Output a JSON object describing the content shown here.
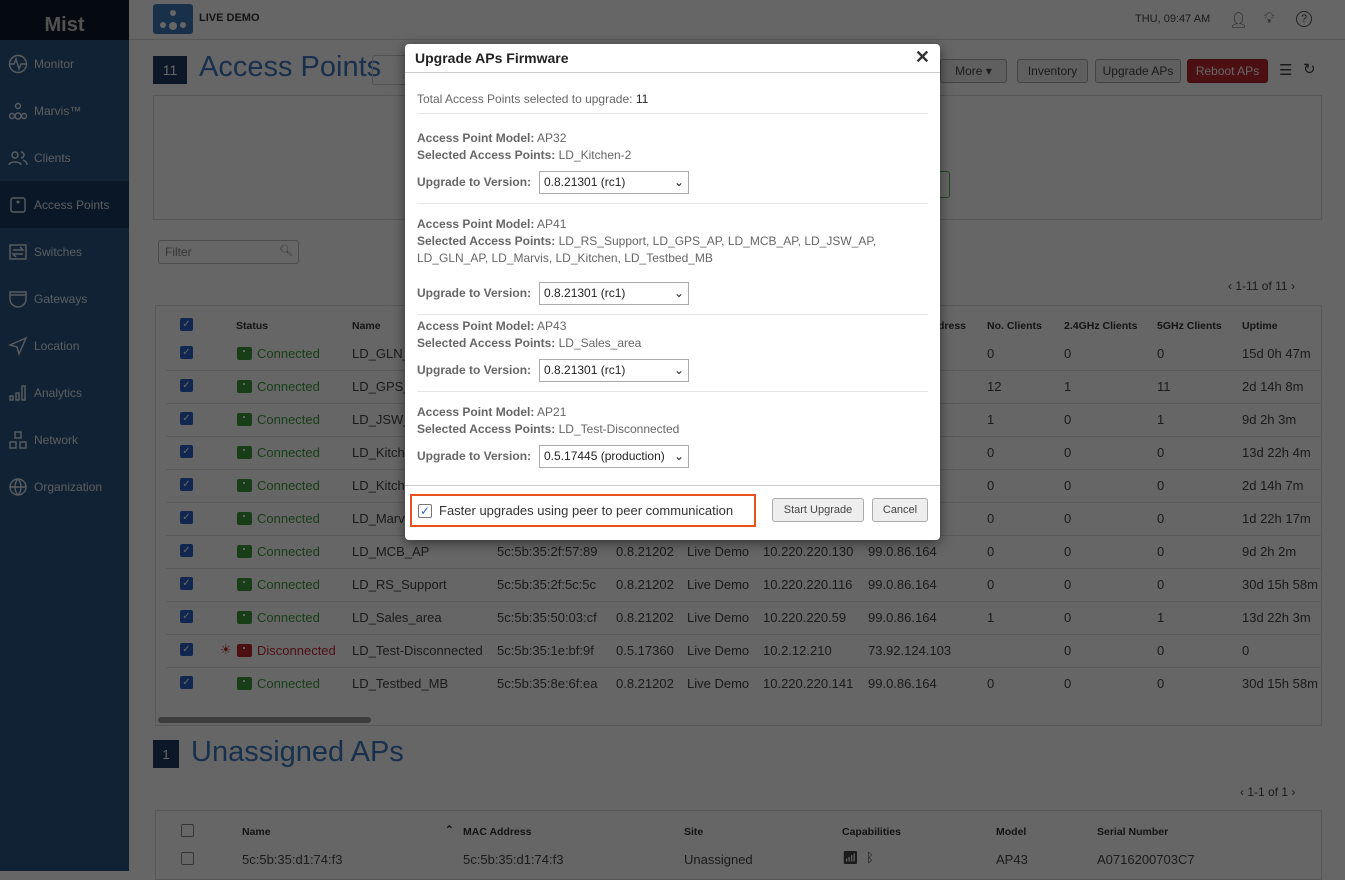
{
  "brand": "Mist",
  "site": "LIVE DEMO",
  "datetime": "THU, 09:47 AM",
  "sidebar": {
    "items": [
      {
        "label": "Monitor",
        "icon": "monitor-icon"
      },
      {
        "label": "Marvis™",
        "icon": "marvis-icon"
      },
      {
        "label": "Clients",
        "icon": "clients-icon"
      },
      {
        "label": "Access Points",
        "icon": "access-point-icon",
        "active": true
      },
      {
        "label": "Switches",
        "icon": "switches-icon"
      },
      {
        "label": "Gateways",
        "icon": "gateways-icon"
      },
      {
        "label": "Location",
        "icon": "location-icon"
      },
      {
        "label": "Analytics",
        "icon": "analytics-icon"
      },
      {
        "label": "Network",
        "icon": "network-icon"
      },
      {
        "label": "Organization",
        "icon": "organization-icon"
      }
    ]
  },
  "ap": {
    "count": "11",
    "title": "Access Points",
    "toolbar": {
      "more": "More",
      "inventory": "Inventory",
      "upgrade": "Upgrade APs",
      "reboot": "Reboot APs"
    },
    "filter_placeholder": "Filter",
    "pagination": "1-11 of 11",
    "headers": {
      "status": "Status",
      "name": "Name",
      "address": "Address",
      "clients": "No. Clients",
      "c24": "2.4GHz Clients",
      "c5": "5GHz Clients",
      "uptime": "Uptime"
    },
    "rows": [
      {
        "status": "Connected",
        "name": "LD_GLN_AP",
        "mac": "",
        "ver": "",
        "site": "",
        "ip": "",
        "ext": "",
        "clients": "0",
        "c24": "0",
        "c5": "0",
        "uptime": "15d 0h 47m"
      },
      {
        "status": "Connected",
        "name": "LD_GPS_AP",
        "mac": "",
        "ver": "",
        "site": "",
        "ip": "",
        "ext": "",
        "clients": "12",
        "c24": "1",
        "c5": "11",
        "uptime": "2d 14h 8m"
      },
      {
        "status": "Connected",
        "name": "LD_JSW_AP",
        "mac": "",
        "ver": "",
        "site": "",
        "ip": "",
        "ext": "",
        "clients": "1",
        "c24": "0",
        "c5": "1",
        "uptime": "9d 2h 3m"
      },
      {
        "status": "Connected",
        "name": "LD_Kitchen",
        "mac": "",
        "ver": "",
        "site": "",
        "ip": "",
        "ext": "",
        "clients": "0",
        "c24": "0",
        "c5": "0",
        "uptime": "13d 22h 4m"
      },
      {
        "status": "Connected",
        "name": "LD_Kitchen-2",
        "mac": "",
        "ver": "",
        "site": "",
        "ip": "",
        "ext": "",
        "clients": "0",
        "c24": "0",
        "c5": "0",
        "uptime": "2d 14h 7m"
      },
      {
        "status": "Connected",
        "name": "LD_Marvis",
        "mac": "",
        "ver": "",
        "site": "",
        "ip": "",
        "ext": "",
        "clients": "0",
        "c24": "0",
        "c5": "0",
        "uptime": "1d 22h 17m"
      },
      {
        "status": "Connected",
        "name": "LD_MCB_AP",
        "mac": "5c:5b:35:2f:57:89",
        "ver": "0.8.21202",
        "site": "Live Demo",
        "ip": "10.220.220.130",
        "ext": "99.0.86.164",
        "clients": "0",
        "c24": "0",
        "c5": "0",
        "uptime": "9d 2h 2m"
      },
      {
        "status": "Connected",
        "name": "LD_RS_Support",
        "mac": "5c:5b:35:2f:5c:5c",
        "ver": "0.8.21202",
        "site": "Live Demo",
        "ip": "10.220.220.116",
        "ext": "99.0.86.164",
        "clients": "0",
        "c24": "0",
        "c5": "0",
        "uptime": "30d 15h 58m"
      },
      {
        "status": "Connected",
        "name": "LD_Sales_area",
        "mac": "5c:5b:35:50:03:cf",
        "ver": "0.8.21202",
        "site": "Live Demo",
        "ip": "10.220.220.59",
        "ext": "99.0.86.164",
        "clients": "1",
        "c24": "0",
        "c5": "1",
        "uptime": "13d 22h 3m"
      },
      {
        "status": "Disconnected",
        "name": "LD_Test-Disconnected",
        "mac": "5c:5b:35:1e:bf:9f",
        "ver": "0.5.17360",
        "site": "Live Demo",
        "ip": "10.2.12.210",
        "ext": "73.92.124.103",
        "clients": "",
        "c24": "0",
        "c5": "0",
        "uptime": "0"
      },
      {
        "status": "Connected",
        "name": "LD_Testbed_MB",
        "mac": "5c:5b:35:8e:6f:ea",
        "ver": "0.8.21202",
        "site": "Live Demo",
        "ip": "10.220.220.141",
        "ext": "99.0.86.164",
        "clients": "0",
        "c24": "0",
        "c5": "0",
        "uptime": "30d 15h 58m"
      }
    ]
  },
  "unassigned": {
    "count": "1",
    "title": "Unassigned APs",
    "pagination": "1-1 of 1",
    "headers": {
      "name": "Name",
      "mac": "MAC Address",
      "site": "Site",
      "cap": "Capabilities",
      "model": "Model",
      "serial": "Serial Number"
    },
    "rows": [
      {
        "name": "5c:5b:35:d1:74:f3",
        "mac": "5c:5b:35:d1:74:f3",
        "site": "Unassigned",
        "model": "AP43",
        "serial": "A0716200703C7"
      }
    ]
  },
  "modal": {
    "title": "Upgrade APs Firmware",
    "total_label": "Total Access Points selected to upgrade:",
    "total": "11",
    "model_label": "Access Point Model:",
    "selected_label": "Selected Access Points:",
    "version_label": "Upgrade to Version:",
    "groups": [
      {
        "model": "AP32",
        "aps": "LD_Kitchen-2",
        "version": "0.8.21301 (rc1)"
      },
      {
        "model": "AP41",
        "aps": "LD_RS_Support, LD_GPS_AP, LD_MCB_AP, LD_JSW_AP, LD_GLN_AP, LD_Marvis, LD_Kitchen, LD_Testbed_MB",
        "version": "0.8.21301 (rc1)"
      },
      {
        "model": "AP43",
        "aps": "LD_Sales_area",
        "version": "0.8.21301 (rc1)"
      },
      {
        "model": "AP21",
        "aps": "LD_Test-Disconnected",
        "version": "0.5.17445 (production)"
      }
    ],
    "p2p_label": "Faster upgrades using peer to peer communication",
    "p2p_checked": true,
    "start": "Start Upgrade",
    "cancel": "Cancel"
  },
  "colors": {
    "accent": "#3b78c0",
    "connected": "#3d9a3d",
    "disconnected": "#c0282d",
    "highlight": "#e8501e",
    "reboot": "#c0282d"
  }
}
